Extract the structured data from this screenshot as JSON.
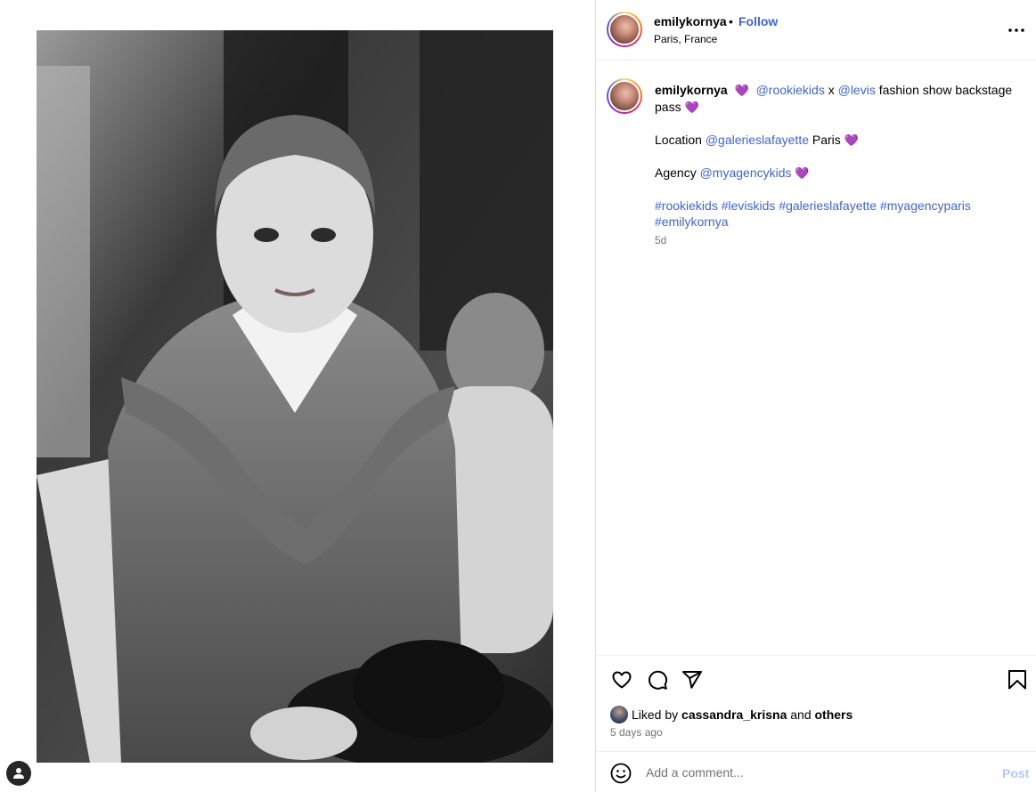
{
  "post": {
    "username": "emilykornya",
    "follow_label": "Follow",
    "separator": "•",
    "location": "Paris, France"
  },
  "caption": {
    "username": "emilykornya",
    "line1_heart": "💜",
    "mention1": "@rookiekids",
    "x": "x",
    "mention2": "@levis",
    "line1_text": "fashion show backstage pass",
    "line1_heart2": "💜",
    "location_label": "Location",
    "location_mention": "@galerieslafayette",
    "location_city": "Paris",
    "location_heart": "💜",
    "agency_label": "Agency",
    "agency_mention": "@myagencykids",
    "agency_heart": "💜",
    "hashtags": [
      "#rookiekids",
      "#leviskids",
      "#galerieslafayette",
      "#myagencyparis",
      "#emilykornya"
    ],
    "time": "5d"
  },
  "likes": {
    "prefix": "Liked by",
    "user": "cassandra_krisna",
    "and": "and",
    "others": "others"
  },
  "date": "5 days ago",
  "comment": {
    "placeholder": "Add a comment...",
    "post_label": "Post"
  },
  "colors": {
    "link": "#4165c4",
    "muted": "#737373",
    "post_disabled": "#b6c8f3"
  },
  "icons": {
    "more": "more-horizontal-icon",
    "like": "heart-icon",
    "comment": "comment-icon",
    "share": "share-icon",
    "save": "bookmark-icon",
    "emoji": "emoji-icon",
    "user": "user-icon"
  }
}
